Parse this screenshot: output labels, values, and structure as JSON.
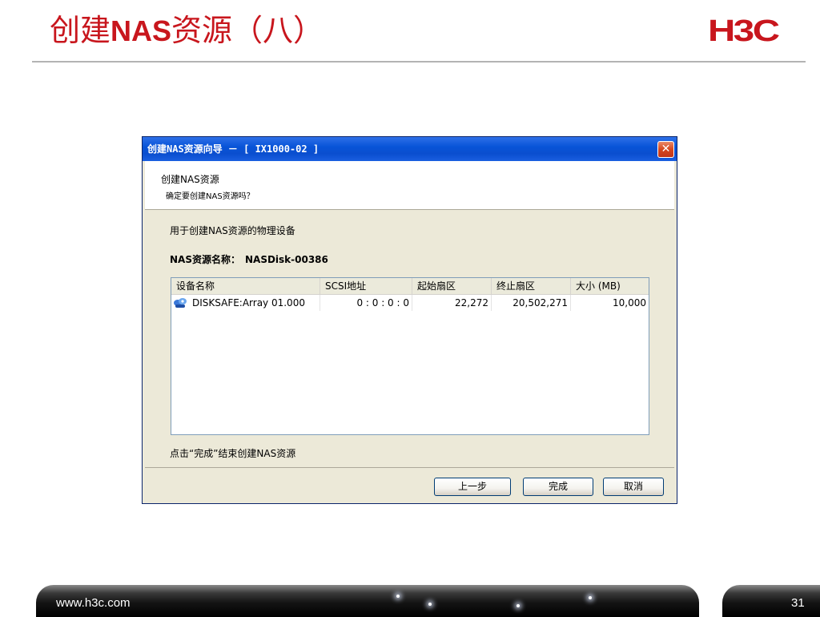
{
  "slide": {
    "title_part1": "创建",
    "title_bold": "NAS",
    "title_part2": "资源（八）",
    "logo": "H3C",
    "footer_url": "www.h3c.com",
    "page_number": "31"
  },
  "dialog": {
    "title": "创建NAS资源向导 － [ IX1000-02 ]",
    "close_icon": "close-icon",
    "header": {
      "title": "创建NAS资源",
      "subtitle": "确定要创建NAS资源吗？"
    },
    "description": "用于创建NAS资源的物理设备",
    "resource_name_label": "NAS资源名称：",
    "resource_name_value": "NASDisk-00386",
    "table": {
      "columns": [
        "设备名称",
        "SCSI地址",
        "起始扇区",
        "终止扇区",
        "大小 (MB)"
      ],
      "rows": [
        {
          "icon": "disk-device-icon",
          "device": "DISKSAFE:Array 01.000",
          "scsi": "0 : 0 : 0 : 0",
          "start": "22,272",
          "end": "20,502,271",
          "size": "10,000"
        }
      ]
    },
    "finish_hint": "点击“完成”结束创建NAS资源",
    "buttons": {
      "prev": "上一步",
      "finish": "完成",
      "cancel": "取消"
    }
  },
  "colors": {
    "title_red": "#c8161d",
    "titlebar_blue": "#0854d8",
    "dialog_bg": "#ece9d8"
  }
}
